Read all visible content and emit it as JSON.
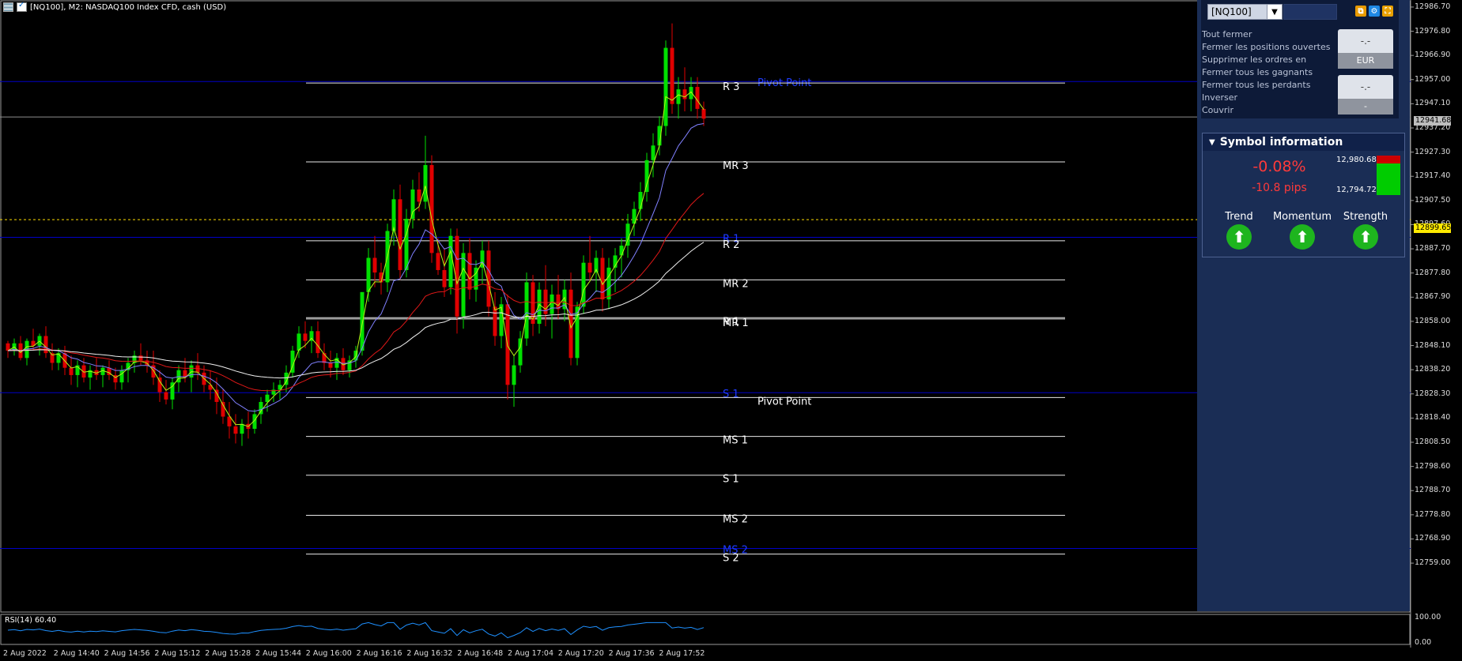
{
  "header": {
    "title": "[NQ100], M2:  NASDAQ100 Index CFD, cash (USD)"
  },
  "colors": {
    "background": "#000000",
    "bull": "#00e000",
    "bear": "#e00000",
    "panel": "#1a2d55",
    "pivot_blue": "#0000c8",
    "accent_red": "#ff3a3a"
  },
  "chart_data": {
    "type": "candlestick",
    "symbol": "NQ100",
    "timeframe": "M2",
    "ylim": [
      12749,
      12987
    ],
    "current_price": 12941.68,
    "reference_price": 12899.65,
    "y_ticks": [
      "12986.70",
      "12976.80",
      "12966.90",
      "12957.00",
      "12947.10",
      "12937.20",
      "12927.30",
      "12917.40",
      "12907.50",
      "12897.60",
      "12887.70",
      "12877.80",
      "12867.90",
      "12858.00",
      "12848.10",
      "12838.20",
      "12828.30",
      "12818.40",
      "12808.50",
      "12798.60",
      "12788.70",
      "12778.80",
      "12768.90",
      "12759.00"
    ],
    "x_ticks": [
      "2 Aug 2022",
      "2 Aug 14:40",
      "2 Aug 14:56",
      "2 Aug 15:12",
      "2 Aug 15:28",
      "2 Aug 15:44",
      "2 Aug 16:00",
      "2 Aug 16:16",
      "2 Aug 16:32",
      "2 Aug 16:48",
      "2 Aug 17:04",
      "2 Aug 17:20",
      "2 Aug 17:36",
      "2 Aug 17:52"
    ],
    "levels_white": [
      {
        "label": "R 3",
        "value": 12955.6
      },
      {
        "label": "MR 3",
        "value": 12923.3
      },
      {
        "label": "R 2",
        "value": 12891.0
      },
      {
        "label": "MR 2",
        "value": 12875.0
      },
      {
        "label": "R 1",
        "value": 12859.5
      },
      {
        "label": "MR 1",
        "value": 12859.0
      },
      {
        "label": "Pivot Point",
        "value": 12826.8
      },
      {
        "label": "MS 1",
        "value": 12810.9
      },
      {
        "label": "S 1",
        "value": 12795.0
      },
      {
        "label": "MS 2",
        "value": 12778.6
      },
      {
        "label": "S 2",
        "value": 12762.7
      }
    ],
    "levels_blue": [
      {
        "label": "Pivot Point",
        "value": 12956.2
      },
      {
        "label": "R 1",
        "value": 12892.4
      },
      {
        "label": "S 1",
        "value": 12828.8
      },
      {
        "label": "MS 2",
        "value": 12765.0
      }
    ],
    "ohlc": [
      [
        12849,
        12850,
        12843,
        12846
      ],
      [
        12846,
        12851,
        12844,
        12849
      ],
      [
        12849,
        12852,
        12842,
        12843
      ],
      [
        12843,
        12851,
        12840,
        12850
      ],
      [
        12850,
        12855,
        12846,
        12848
      ],
      [
        12848,
        12853,
        12844,
        12852
      ],
      [
        12852,
        12856,
        12843,
        12845
      ],
      [
        12845,
        12849,
        12838,
        12841
      ],
      [
        12841,
        12847,
        12838,
        12845
      ],
      [
        12845,
        12848,
        12836,
        12839
      ],
      [
        12839,
        12844,
        12832,
        12836
      ],
      [
        12836,
        12842,
        12831,
        12840
      ],
      [
        12840,
        12843,
        12833,
        12835
      ],
      [
        12835,
        12840,
        12830,
        12838
      ],
      [
        12838,
        12843,
        12834,
        12836
      ],
      [
        12836,
        12840,
        12831,
        12839
      ],
      [
        12839,
        12842,
        12834,
        12836
      ],
      [
        12836,
        12839,
        12830,
        12833
      ],
      [
        12833,
        12840,
        12830,
        12838
      ],
      [
        12838,
        12843,
        12833,
        12841
      ],
      [
        12841,
        12846,
        12837,
        12844
      ],
      [
        12844,
        12849,
        12840,
        12842
      ],
      [
        12842,
        12846,
        12837,
        12840
      ],
      [
        12840,
        12846,
        12832,
        12835
      ],
      [
        12835,
        12838,
        12825,
        12829
      ],
      [
        12829,
        12834,
        12824,
        12826
      ],
      [
        12826,
        12835,
        12822,
        12833
      ],
      [
        12833,
        12840,
        12829,
        12838
      ],
      [
        12838,
        12843,
        12833,
        12835
      ],
      [
        12835,
        12842,
        12829,
        12840
      ],
      [
        12840,
        12845,
        12834,
        12837
      ],
      [
        12837,
        12840,
        12829,
        12832
      ],
      [
        12832,
        12838,
        12826,
        12830
      ],
      [
        12830,
        12835,
        12820,
        12825
      ],
      [
        12825,
        12830,
        12816,
        12819
      ],
      [
        12819,
        12825,
        12810,
        12815
      ],
      [
        12815,
        12820,
        12808,
        12812
      ],
      [
        12812,
        12818,
        12807,
        12816
      ],
      [
        12816,
        12821,
        12810,
        12814
      ],
      [
        12814,
        12822,
        12812,
        12820
      ],
      [
        12820,
        12827,
        12816,
        12825
      ],
      [
        12825,
        12830,
        12821,
        12828
      ],
      [
        12828,
        12833,
        12825,
        12830
      ],
      [
        12830,
        12834,
        12826,
        12832
      ],
      [
        12832,
        12840,
        12829,
        12837
      ],
      [
        12837,
        12848,
        12835,
        12846
      ],
      [
        12846,
        12856,
        12843,
        12853
      ],
      [
        12853,
        12858,
        12847,
        12850
      ],
      [
        12850,
        12856,
        12845,
        12854
      ],
      [
        12854,
        12858,
        12843,
        12845
      ],
      [
        12845,
        12849,
        12838,
        12841
      ],
      [
        12841,
        12846,
        12835,
        12839
      ],
      [
        12839,
        12845,
        12834,
        12843
      ],
      [
        12843,
        12847,
        12836,
        12838
      ],
      [
        12838,
        12844,
        12835,
        12842
      ],
      [
        12842,
        12848,
        12839,
        12846
      ],
      [
        12846,
        12860,
        12844,
        12870
      ],
      [
        12870,
        12888,
        12866,
        12884
      ],
      [
        12884,
        12893,
        12872,
        12878
      ],
      [
        12878,
        12882,
        12869,
        12874
      ],
      [
        12874,
        12898,
        12870,
        12895
      ],
      [
        12895,
        12912,
        12889,
        12908
      ],
      [
        12908,
        12914,
        12875,
        12879
      ],
      [
        12879,
        12904,
        12876,
        12900
      ],
      [
        12900,
        12916,
        12896,
        12912
      ],
      [
        12912,
        12919,
        12903,
        12907
      ],
      [
        12907,
        12934,
        12904,
        12922
      ],
      [
        12922,
        12926,
        12882,
        12886
      ],
      [
        12886,
        12892,
        12877,
        12879
      ],
      [
        12879,
        12888,
        12868,
        12872
      ],
      [
        12872,
        12896,
        12869,
        12893
      ],
      [
        12893,
        12896,
        12853,
        12860
      ],
      [
        12860,
        12890,
        12855,
        12886
      ],
      [
        12886,
        12892,
        12867,
        12871
      ],
      [
        12871,
        12883,
        12866,
        12880
      ],
      [
        12880,
        12891,
        12873,
        12887
      ],
      [
        12887,
        12891,
        12860,
        12864
      ],
      [
        12864,
        12870,
        12848,
        12852
      ],
      [
        12852,
        12868,
        12847,
        12865
      ],
      [
        12865,
        12869,
        12826,
        12832
      ],
      [
        12832,
        12844,
        12823,
        12840
      ],
      [
        12840,
        12854,
        12837,
        12851
      ],
      [
        12851,
        12878,
        12848,
        12874
      ],
      [
        12874,
        12877,
        12852,
        12857
      ],
      [
        12857,
        12874,
        12853,
        12871
      ],
      [
        12871,
        12881,
        12856,
        12861
      ],
      [
        12861,
        12873,
        12851,
        12869
      ],
      [
        12869,
        12877,
        12859,
        12863
      ],
      [
        12863,
        12875,
        12858,
        12871
      ],
      [
        12871,
        12878,
        12840,
        12843
      ],
      [
        12843,
        12866,
        12840,
        12864
      ],
      [
        12864,
        12885,
        12861,
        12882
      ],
      [
        12882,
        12893,
        12875,
        12878
      ],
      [
        12878,
        12887,
        12870,
        12884
      ],
      [
        12884,
        12888,
        12862,
        12867
      ],
      [
        12867,
        12884,
        12863,
        12880
      ],
      [
        12880,
        12888,
        12870,
        12885
      ],
      [
        12885,
        12892,
        12876,
        12889
      ],
      [
        12889,
        12902,
        12884,
        12898
      ],
      [
        12898,
        12907,
        12893,
        12904
      ],
      [
        12904,
        12915,
        12899,
        12911
      ],
      [
        12911,
        12927,
        12907,
        12924
      ],
      [
        12924,
        12935,
        12917,
        12930
      ],
      [
        12930,
        12942,
        12926,
        12938
      ],
      [
        12938,
        12973,
        12934,
        12970
      ],
      [
        12970,
        12980,
        12943,
        12947
      ],
      [
        12947,
        12958,
        12941,
        12953
      ],
      [
        12953,
        12962,
        12944,
        12949
      ],
      [
        12949,
        12958,
        12944,
        12954
      ],
      [
        12954,
        12958,
        12941,
        12945
      ],
      [
        12945,
        12948,
        12938,
        12941
      ]
    ],
    "rsi": {
      "label": "RSI(14) 60.40",
      "value": 60.4,
      "ylim": [
        0,
        100
      ],
      "y_ticks": [
        "100.00",
        "0.00"
      ]
    }
  },
  "panel": {
    "symbol": "[NQ100]",
    "menu": [
      "Tout fermer",
      "Fermer les positions ouvertes",
      "Supprimer les ordres en",
      "Fermer tous les gagnants",
      "Fermer tous les perdants",
      "Inverser",
      "Couvrir"
    ],
    "btn_top1": "-.-",
    "btn_currency": "EUR",
    "btn_top2": "-.-",
    "btn_dash": "-",
    "symbol_info": {
      "title": "Symbol information",
      "change_pct": "-0.08%",
      "change_pips": "-10.8 pips",
      "high": "12,980.68",
      "low": "12,794.72",
      "indicators": [
        "Trend",
        "Momentum",
        "Strength"
      ]
    }
  },
  "price_tags": {
    "current": "12941.68",
    "reference": "12899.65"
  }
}
